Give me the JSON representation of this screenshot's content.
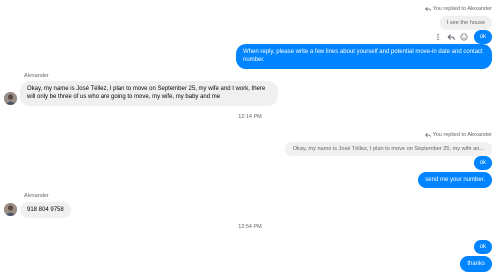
{
  "thread": {
    "reply_meta_1": "You replied to Alexander",
    "quoted_1": "I see the house",
    "out_ok_1": "ok",
    "out_long": "When reply, please write a few lines about yourself and potential move-in date  and contact number.",
    "sender_1": "Alexander",
    "in_long": "Okay, my name is José Téllez, I plan to move on September 25, my wife and I work, there will only be three of us who are going to move, my wife, my baby and me",
    "time_1": "12:14 PM",
    "reply_meta_2": "You replied to Alexander",
    "quoted_2": "Okay, my name is José Téllez, I plan to move on September 25, my wife an...",
    "out_ok_2": "ok",
    "out_send_number": "send me your number.",
    "sender_2": "Alexander",
    "in_phone": "918 804 9758",
    "time_2": "12:54 PM",
    "out_ok_3": "ok",
    "out_thanks": "thanks"
  },
  "icons": {
    "reply": "reply-arrow-icon",
    "more": "more-vertical-icon",
    "emoji": "emoji-smile-icon"
  },
  "colors": {
    "outgoing_bubble": "#0084ff",
    "incoming_bubble": "#f0f0f0",
    "meta_text": "#65676b"
  }
}
